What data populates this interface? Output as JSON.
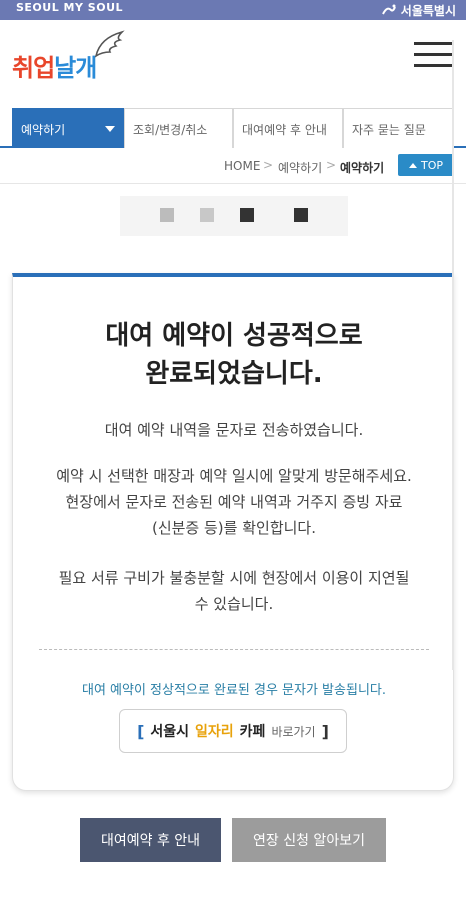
{
  "topbar": {
    "brand": "SEOUL MY SOUL",
    "city": "서울특별시",
    "city_icon": "seoul-logo-icon"
  },
  "header": {
    "logo_text_1": "취업",
    "logo_text_2": "날개",
    "logo_icon": "wing-icon",
    "menu_icon": "hamburger-menu-icon"
  },
  "tabs": [
    {
      "label": "예약하기",
      "active": true
    },
    {
      "label": "조회/변경/취소",
      "active": false
    },
    {
      "label": "대여예약 후 안내",
      "active": false
    },
    {
      "label": "자주 묻는 질문",
      "active": false
    }
  ],
  "breadcrumb": {
    "home": "HOME",
    "level1": "예약하기",
    "current": "예약하기",
    "top_button": "TOP"
  },
  "result": {
    "title_line1": "대여 예약이 성공적으로",
    "title_line2": "완료되었습니다.",
    "msg1": "대여 예약 내역을 문자로 전송하였습니다.",
    "msg2_line1": "예약 시 선택한 매장과 예약 일시에 알맞게 방문해주세요.",
    "msg2_line2": "현장에서 문자로 전송된 예약 내역과 거주지 증빙 자료",
    "msg2_line3": "(신분증 등)를 확인합니다.",
    "msg3_line1": "필요 서류 구비가 불충분할 시에 현장에서 이용이 지연될",
    "msg3_line2": "수 있습니다.",
    "notice": "대여 예약이 정상적으로 완료된 경우 문자가 발송됩니다.",
    "cafe_part1": "서울시",
    "cafe_part2": "일자리",
    "cafe_part3": "카페",
    "cafe_link": "바로가기"
  },
  "bottom_buttons": {
    "after_guide": "대여예약 후 안내",
    "extend": "연장 신청 알아보기"
  },
  "colors": {
    "topbar": "#6b79b3",
    "accent_blue": "#2a6fb8",
    "notice_blue": "#2a7fa6",
    "cafe_gold": "#e8a20b",
    "btn_dark": "#4b5670",
    "btn_gray": "#9c9c9c"
  }
}
